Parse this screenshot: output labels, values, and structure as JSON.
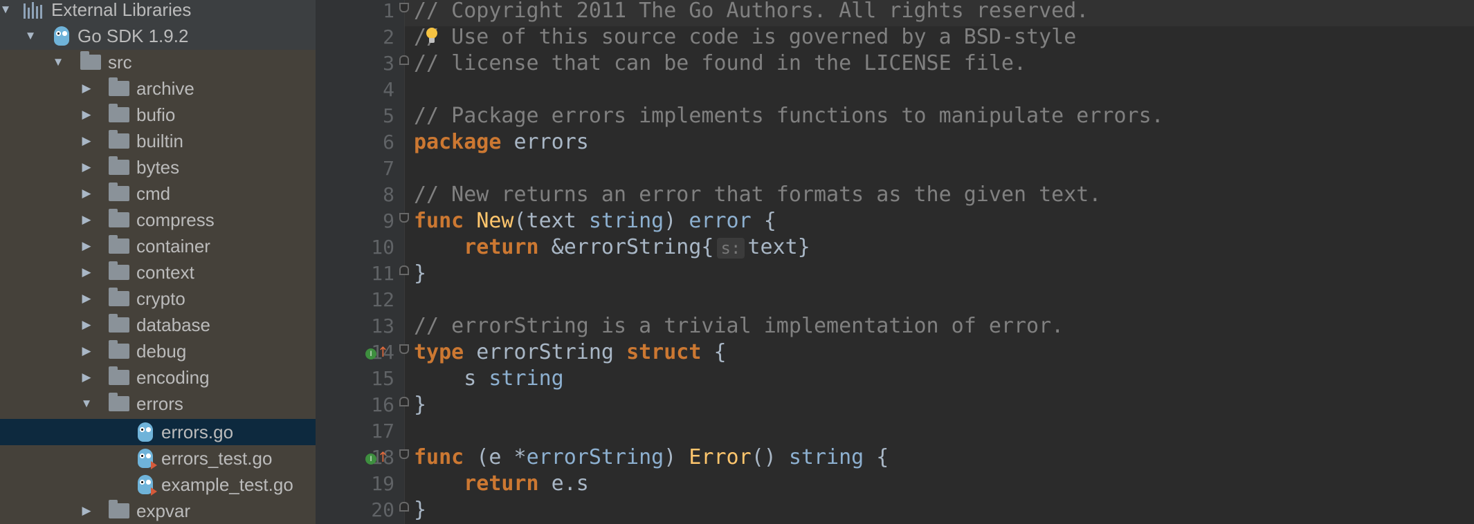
{
  "project_tree": {
    "items": [
      {
        "label": "External Libraries",
        "icon": "library-icon",
        "expanded": true
      },
      {
        "label": "Go SDK 1.9.2",
        "icon": "gopher-icon",
        "expanded": true
      },
      {
        "label": "src",
        "icon": "folder-icon",
        "expanded": true
      },
      {
        "label": "archive",
        "icon": "folder-icon",
        "expanded": false
      },
      {
        "label": "bufio",
        "icon": "folder-icon",
        "expanded": false
      },
      {
        "label": "builtin",
        "icon": "folder-icon",
        "expanded": false
      },
      {
        "label": "bytes",
        "icon": "folder-icon",
        "expanded": false
      },
      {
        "label": "cmd",
        "icon": "folder-icon",
        "expanded": false
      },
      {
        "label": "compress",
        "icon": "folder-icon",
        "expanded": false
      },
      {
        "label": "container",
        "icon": "folder-icon",
        "expanded": false
      },
      {
        "label": "context",
        "icon": "folder-icon",
        "expanded": false
      },
      {
        "label": "crypto",
        "icon": "folder-icon",
        "expanded": false
      },
      {
        "label": "database",
        "icon": "folder-icon",
        "expanded": false
      },
      {
        "label": "debug",
        "icon": "folder-icon",
        "expanded": false
      },
      {
        "label": "encoding",
        "icon": "folder-icon",
        "expanded": false
      },
      {
        "label": "errors",
        "icon": "folder-icon",
        "expanded": true
      },
      {
        "label": "errors.go",
        "icon": "go-file-icon",
        "selected": true
      },
      {
        "label": "errors_test.go",
        "icon": "go-test-file-icon"
      },
      {
        "label": "example_test.go",
        "icon": "go-test-file-icon"
      },
      {
        "label": "expvar",
        "icon": "folder-icon",
        "expanded": false
      }
    ]
  },
  "editor": {
    "line_numbers": [
      "1",
      "2",
      "3",
      "4",
      "5",
      "6",
      "7",
      "8",
      "9",
      "10",
      "11",
      "12",
      "13",
      "14",
      "15",
      "16",
      "17",
      "18",
      "19",
      "20"
    ],
    "lines": [
      {
        "comment": "// Copyright 2011 The Go Authors. All rights reserved."
      },
      {
        "comment": "/",
        "comment2": "/ Use of this source code is governed by a BSD-style"
      },
      {
        "comment": "// license that can be found in the LICENSE file."
      },
      {},
      {
        "comment": "// Package errors implements functions to manipulate errors."
      },
      {
        "kw": "package",
        "rest": " errors"
      },
      {},
      {
        "comment": "// New returns an error that formats as the given text."
      },
      {
        "kw": "func",
        "fn": "New",
        "p1": "(text ",
        "t1": "string",
        "p2": ") ",
        "t2": "error",
        "p3": " {"
      },
      {
        "indent": "    ",
        "kw": "return",
        "p1": " &errorString{",
        "hint": "s:",
        "p2": "text}"
      },
      {
        "p1": "}"
      },
      {},
      {
        "comment": "// errorString is a trivial implementation of error."
      },
      {
        "kw": "type",
        "p1": " errorString ",
        "kw2": "struct",
        "p2": " {"
      },
      {
        "indent": "    ",
        "p1": "s ",
        "t1": "string"
      },
      {
        "p1": "}"
      },
      {},
      {
        "kw": "func",
        "p1": " (e *",
        "t1": "errorString",
        "p2": ") ",
        "fn": "Error",
        "p3": "() ",
        "t2": "string",
        "p4": " {"
      },
      {
        "indent": "    ",
        "kw": "return",
        "p1": " e.s"
      },
      {
        "p1": "}"
      }
    ],
    "gutter_markers": {
      "implements_line_14": "I",
      "implements_line_18": "I"
    }
  }
}
